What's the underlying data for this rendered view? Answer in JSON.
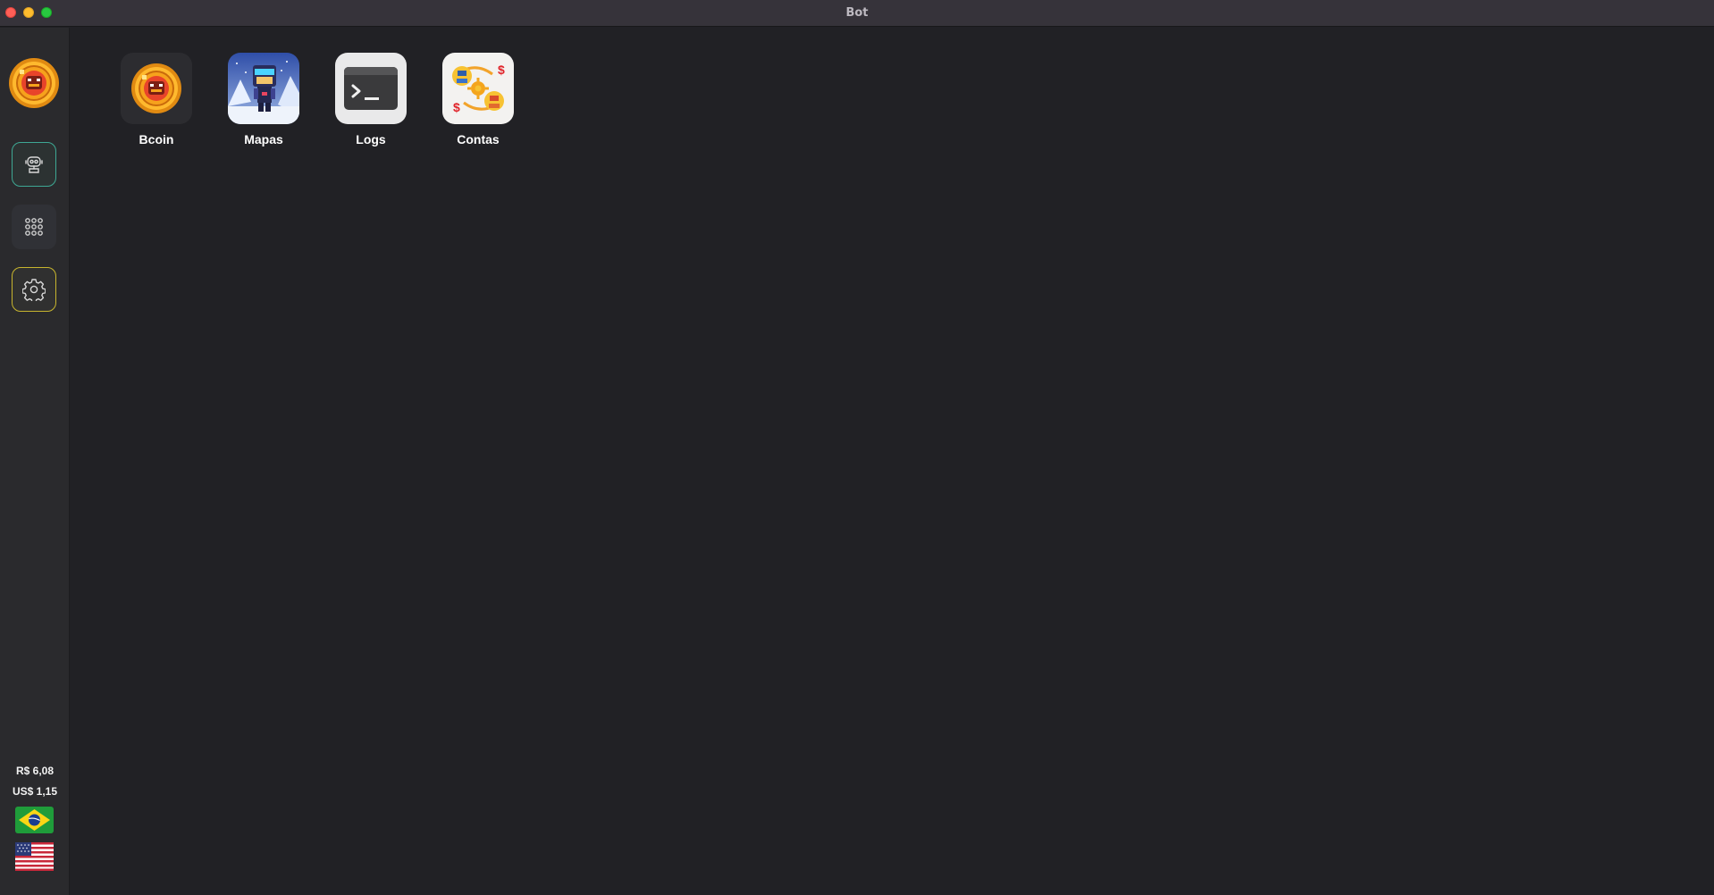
{
  "window": {
    "title": "Bot"
  },
  "sidebar": {
    "logo_icon": "bcoin-coin-icon",
    "nav": [
      {
        "id": "bot",
        "icon": "robot-icon",
        "accent": "#3ea894"
      },
      {
        "id": "apps",
        "icon": "grid-dots-icon"
      },
      {
        "id": "settings",
        "icon": "gear-icon",
        "accent": "#c7b52e"
      }
    ],
    "prices": {
      "brl": "R$ 6,08",
      "usd": "US$ 1,15"
    },
    "languages": [
      "brazil-flag-icon",
      "usa-flag-icon"
    ]
  },
  "apps": [
    {
      "label": "Bcoin",
      "icon": "bcoin-coin-icon"
    },
    {
      "label": "Mapas",
      "icon": "map-character-icon"
    },
    {
      "label": "Logs",
      "icon": "terminal-icon"
    },
    {
      "label": "Contas",
      "icon": "accounts-exchange-icon"
    }
  ],
  "colors": {
    "background": "#212125",
    "sidebar": "#2a2a2d",
    "titlebar": "#36333a"
  }
}
